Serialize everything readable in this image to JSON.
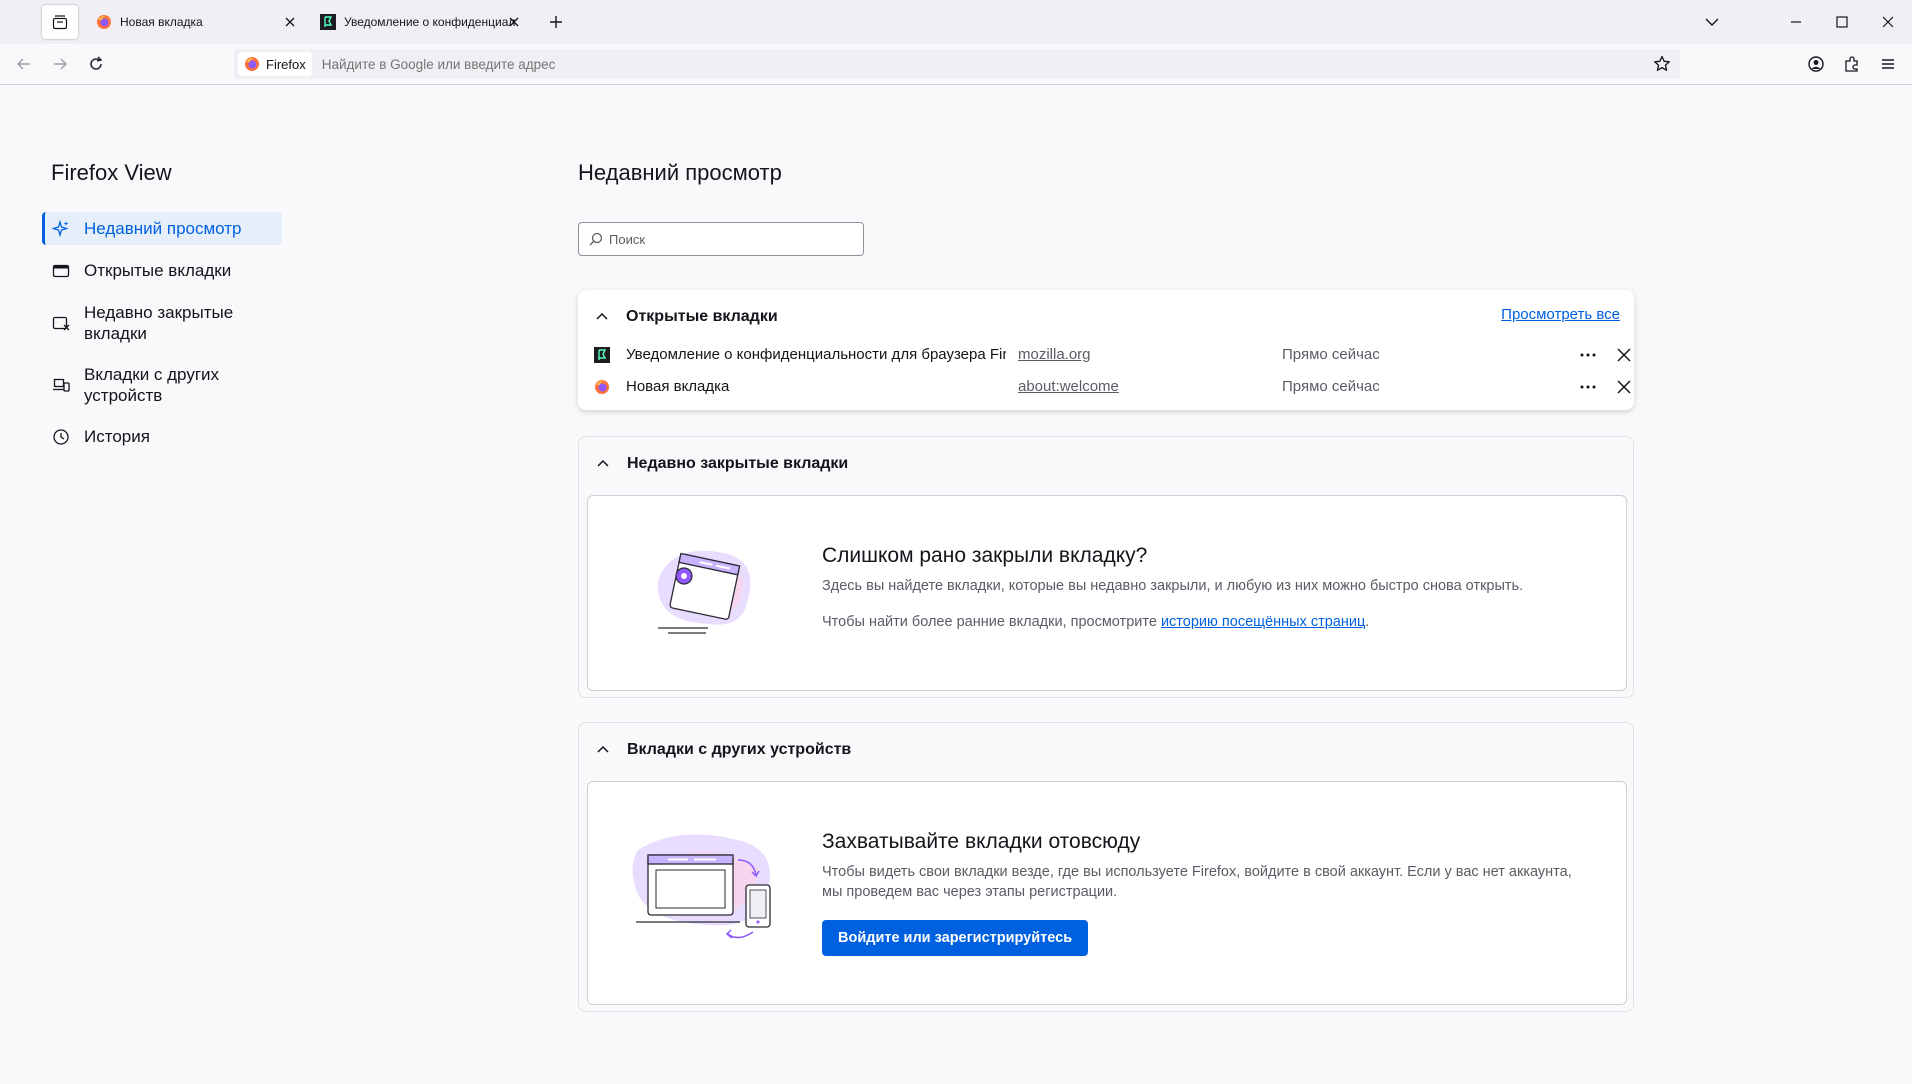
{
  "tabs": [
    {
      "title": "Новая вкладка"
    },
    {
      "title": "Уведомление о конфиденциальности для браузера Firefox"
    }
  ],
  "urlbar": {
    "identity_label": "Firefox",
    "placeholder": "Найдите в Google или введите адрес"
  },
  "sidebar": {
    "title": "Firefox View",
    "items": [
      {
        "label": "Недавний просмотр"
      },
      {
        "label": "Открытые вкладки"
      },
      {
        "label": "Недавно закрытые вкладки"
      },
      {
        "label": "Вкладки с других устройств"
      },
      {
        "label": "История"
      }
    ]
  },
  "main": {
    "title": "Недавний просмотр",
    "search_placeholder": "Поиск",
    "open_tabs": {
      "heading": "Открытые вкладки",
      "view_all": "Просмотреть все",
      "rows": [
        {
          "title": "Уведомление о конфиденциальности для браузера Firefox",
          "url": "mozilla.org",
          "time": "Прямо сейчас"
        },
        {
          "title": "Новая вкладка",
          "url": "about:welcome",
          "time": "Прямо сейчас"
        }
      ]
    },
    "recently_closed": {
      "heading": "Недавно закрытые вкладки",
      "empty_title": "Слишком рано закрыли вкладку?",
      "empty_text": "Здесь вы найдете вкладки, которые вы недавно закрыли, и любую из них можно быстро снова открыть.",
      "history_prefix": "Чтобы найти более ранние вкладки, просмотрите ",
      "history_link": "историю посещённых страниц",
      "history_suffix": "."
    },
    "other_devices": {
      "heading": "Вкладки с других устройств",
      "empty_title": "Захватывайте вкладки отовсюду",
      "empty_text": "Чтобы видеть свои вкладки везде, где вы используете Firefox, войдите в свой аккаунт. Если у вас нет аккаунта, мы проведем вас через этапы регистрации.",
      "button": "Войдите или зарегистрируйтесь"
    }
  },
  "colors": {
    "accent": "#0061e0",
    "sidebar_active_bg": "#e6eef9",
    "page_bg": "#f9f9fb",
    "tabstrip_bg": "#f0f0f4"
  },
  "icons": [
    "firefox-view-icon",
    "firefox-icon",
    "mozilla-icon",
    "close-icon",
    "plus-icon",
    "chevron-down-icon",
    "minimize-icon",
    "maximize-icon",
    "back-icon",
    "forward-icon",
    "reload-icon",
    "star-icon",
    "account-icon",
    "extensions-icon",
    "menu-icon",
    "sparkle-icon",
    "tabs-icon",
    "closed-tabs-icon",
    "devices-icon",
    "history-icon",
    "search-icon",
    "more-icon",
    "chevron-up-icon"
  ]
}
